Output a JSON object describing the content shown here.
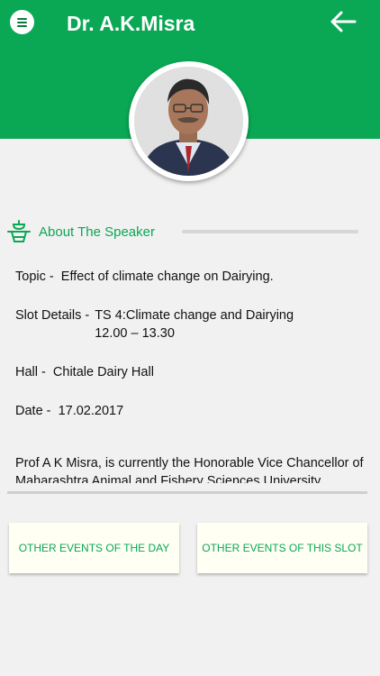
{
  "header": {
    "title": "Dr. A.K.Misra",
    "menu_icon": "menu-icon",
    "back_icon": "arrow-left-icon"
  },
  "section": {
    "label": "About The Speaker",
    "icon": "speaker-podium-icon"
  },
  "details": {
    "topic_label": "Topic -",
    "topic_value": "Effect of climate change on Dairying.",
    "slot_label": "Slot Details -",
    "slot_value_1": "TS 4:Climate change and Dairying",
    "slot_value_2": "12.00 – 13.30",
    "hall_label": "Hall -",
    "hall_value": "Chitale Dairy Hall",
    "date_label": "Date -",
    "date_value": "17.02.2017",
    "bio": "Prof A K Misra, is currently the Honorable Vice Chancellor of Maharashtra Animal and Fishery Sciences University, Nagpur. Prof Misra worked in several"
  },
  "buttons": {
    "other_events_day": "OTHER EVENTS OF THE DAY",
    "other_events_slot": "OTHER EVENTS OF THIS SLOT"
  },
  "colors": {
    "accent": "#0aa854",
    "background": "#f1f1f1",
    "button_bg": "#fffff3"
  }
}
